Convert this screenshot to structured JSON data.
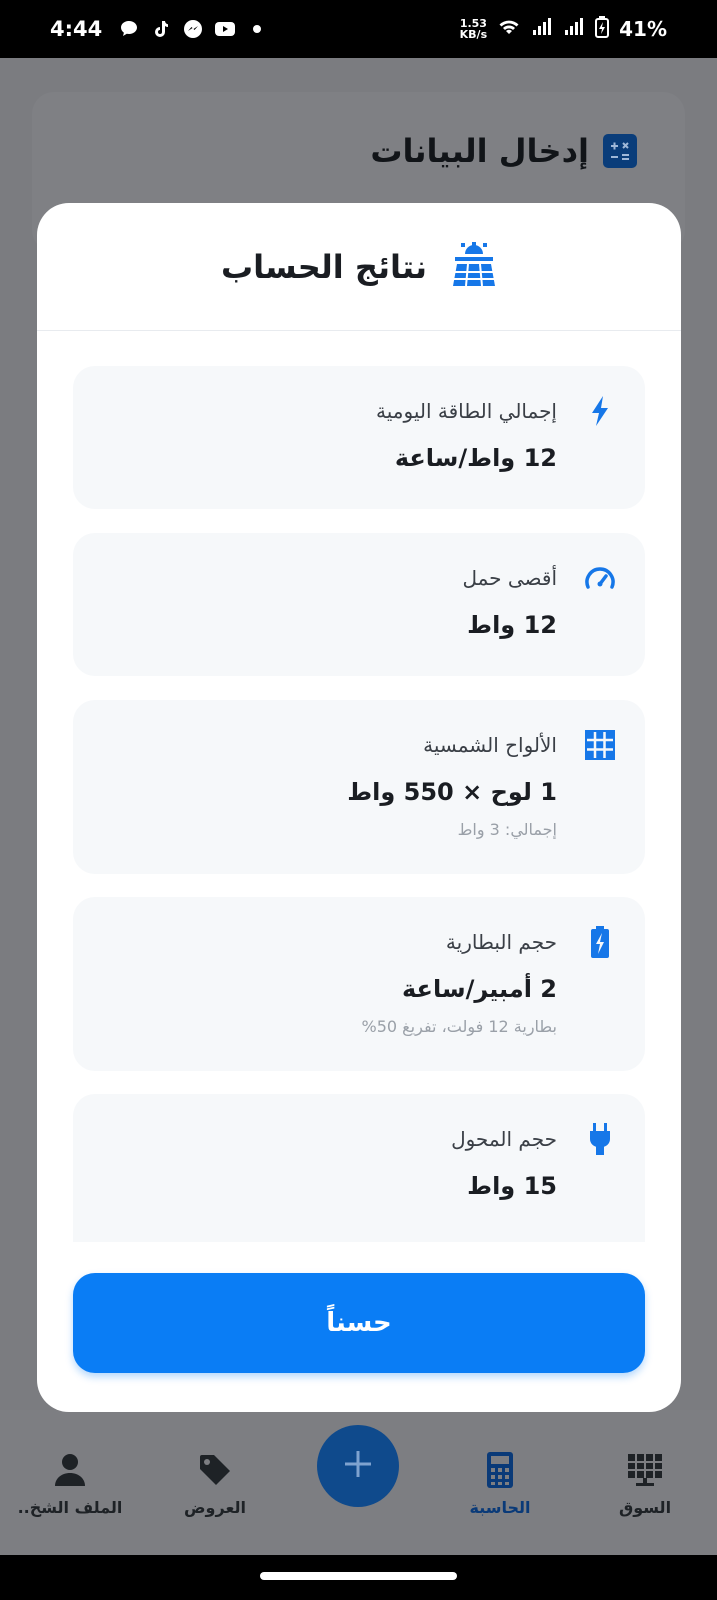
{
  "status_bar": {
    "time": "4:44",
    "net_speed_value": "1.53",
    "net_speed_unit": "KB/s",
    "battery": "41%"
  },
  "background": {
    "section_title": "إدخال البيانات"
  },
  "modal": {
    "title": "نتائج الحساب",
    "results": [
      {
        "label": "إجمالي الطاقة اليومية",
        "value": "12 واط/ساعة",
        "icon": "bolt-icon"
      },
      {
        "label": "أقصى حمل",
        "value": "12 واط",
        "icon": "gauge-icon"
      },
      {
        "label": "الألواح الشمسية",
        "value": "1 لوح × 550 واط",
        "sub": "إجمالي: 3 واط",
        "icon": "solar-grid-icon"
      },
      {
        "label": "حجم البطارية",
        "value": "2 أمبير/ساعة",
        "sub": "بطارية 12 فولت، تفريغ 50%",
        "icon": "battery-charging-icon"
      },
      {
        "label": "حجم المحول",
        "value": "15 واط",
        "icon": "plug-icon"
      }
    ],
    "ok_label": "حسناً"
  },
  "bottom_nav": {
    "items": [
      {
        "label": "الملف الشخ..",
        "icon": "person-icon"
      },
      {
        "label": "العروض",
        "icon": "tag-icon"
      },
      {
        "label": "الحاسبة",
        "icon": "calculator-icon",
        "active": true
      },
      {
        "label": "السوق",
        "icon": "solar-panel-icon"
      }
    ]
  },
  "colors": {
    "accent": "#0a7df5",
    "icon_blue": "#1677e8",
    "nav_active": "#0a3a78"
  }
}
